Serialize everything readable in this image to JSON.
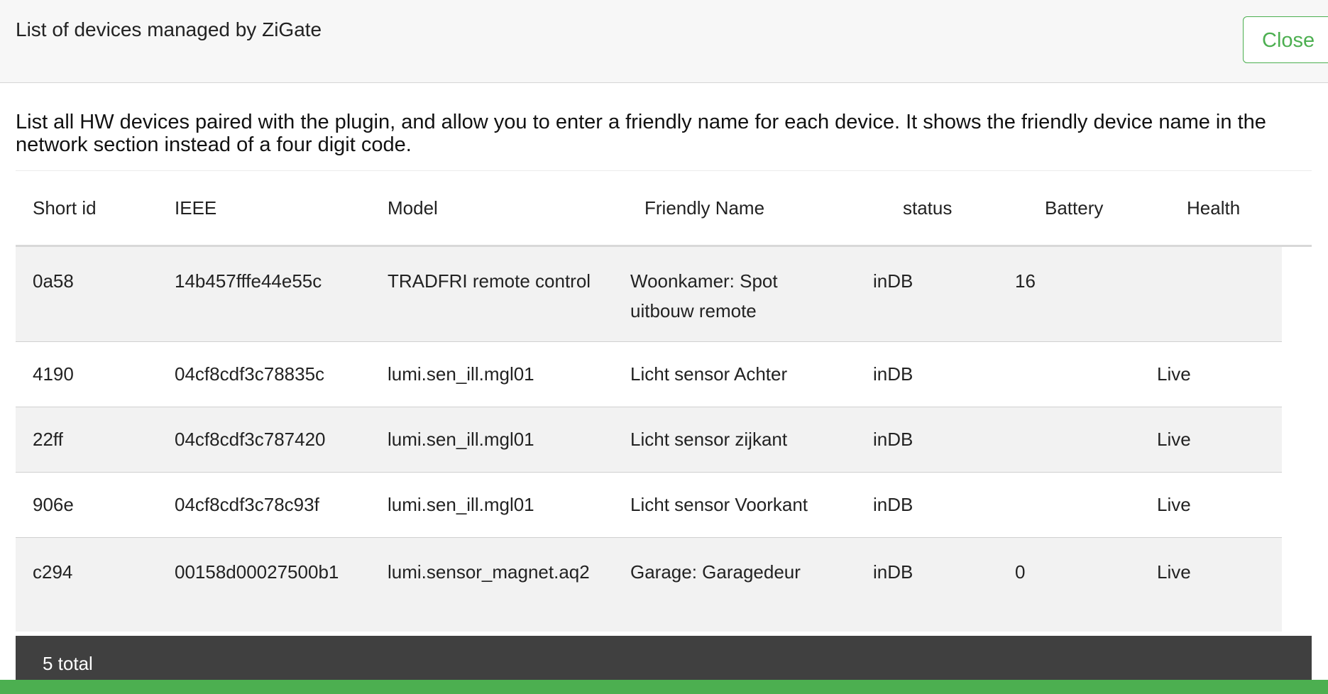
{
  "header": {
    "title": "List of devices managed by ZiGate",
    "close_label": "Close"
  },
  "description": "List all HW devices paired with the plugin, and allow you to enter a friendly name for each device. It shows the friendly device name in the network section instead of a four digit code.",
  "table": {
    "columns": [
      "Short id",
      "IEEE",
      "Model",
      "Friendly Name",
      "status",
      "Battery",
      "Health"
    ],
    "rows": [
      {
        "short_id": "0a58",
        "ieee": "14b457fffe44e55c",
        "model": "TRADFRI remote control",
        "friendly_name": "Woonkamer: Spot uitbouw remote",
        "status": "inDB",
        "battery": "16",
        "health": ""
      },
      {
        "short_id": "4190",
        "ieee": "04cf8cdf3c78835c",
        "model": "lumi.sen_ill.mgl01",
        "friendly_name": "Licht sensor Achter",
        "status": "inDB",
        "battery": "",
        "health": "Live"
      },
      {
        "short_id": "22ff",
        "ieee": "04cf8cdf3c787420",
        "model": "lumi.sen_ill.mgl01",
        "friendly_name": "Licht sensor zijkant",
        "status": "inDB",
        "battery": "",
        "health": "Live"
      },
      {
        "short_id": "906e",
        "ieee": "04cf8cdf3c78c93f",
        "model": "lumi.sen_ill.mgl01",
        "friendly_name": "Licht sensor Voorkant",
        "status": "inDB",
        "battery": "",
        "health": "Live"
      },
      {
        "short_id": "c294",
        "ieee": "00158d00027500b1",
        "model": "lumi.sensor_magnet.aq2",
        "friendly_name": "Garage: Garagedeur",
        "status": "inDB",
        "battery": "0",
        "health": "Live"
      }
    ]
  },
  "footer": {
    "total": "5 total"
  },
  "colors": {
    "accent": "#4caf50",
    "footer_bg": "#404040",
    "row_stripe": "#f2f2f2"
  }
}
